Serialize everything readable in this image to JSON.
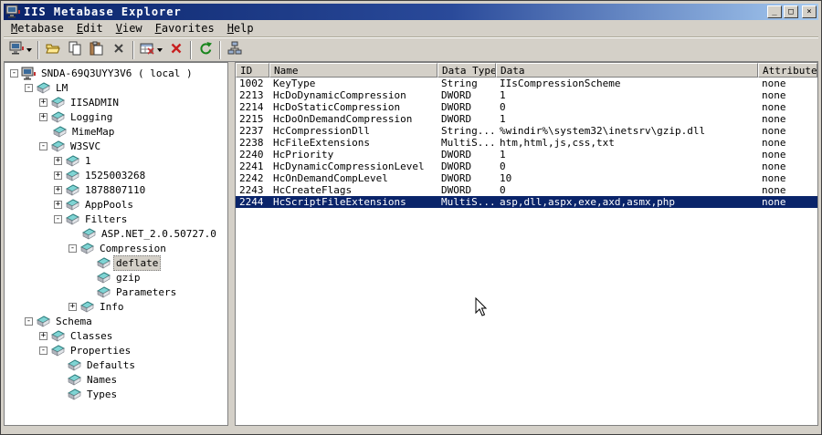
{
  "window": {
    "title": "IIS Metabase Explorer",
    "controls": {
      "minimize": "_",
      "maximize": "□",
      "close": "×"
    }
  },
  "menubar": {
    "items": [
      {
        "label": "Metabase"
      },
      {
        "label": "Edit"
      },
      {
        "label": "View"
      },
      {
        "label": "Favorites"
      },
      {
        "label": "Help"
      }
    ]
  },
  "toolbar": {
    "buttons": [
      {
        "type": "button",
        "name": "connect",
        "icon": "computer",
        "dropdown": true
      },
      {
        "type": "sep"
      },
      {
        "type": "button",
        "name": "open",
        "icon": "folder-open"
      },
      {
        "type": "button",
        "name": "copy",
        "icon": "copy"
      },
      {
        "type": "button",
        "name": "paste",
        "icon": "paste"
      },
      {
        "type": "button",
        "name": "delete",
        "icon": "delete-x"
      },
      {
        "type": "sep"
      },
      {
        "type": "button",
        "name": "new-record",
        "icon": "record-grid",
        "dropdown": true
      },
      {
        "type": "button",
        "name": "delete-record",
        "icon": "delete-red"
      },
      {
        "type": "sep"
      },
      {
        "type": "button",
        "name": "refresh",
        "icon": "refresh"
      },
      {
        "type": "sep"
      },
      {
        "type": "button",
        "name": "network",
        "icon": "network"
      }
    ]
  },
  "tree": {
    "items": [
      {
        "label": "SNDA-69Q3UYY3V6 ( local )",
        "level": 0,
        "expander": "minus",
        "icon": "computer",
        "selected": false
      },
      {
        "label": "LM",
        "level": 1,
        "expander": "minus",
        "icon": "key",
        "selected": false
      },
      {
        "label": "IISADMIN",
        "level": 2,
        "expander": "plus",
        "icon": "key",
        "selected": false
      },
      {
        "label": "Logging",
        "level": 2,
        "expander": "plus",
        "icon": "key",
        "selected": false
      },
      {
        "label": "MimeMap",
        "level": 2,
        "expander": "none",
        "icon": "key",
        "selected": false
      },
      {
        "label": "W3SVC",
        "level": 2,
        "expander": "minus",
        "icon": "key",
        "selected": false
      },
      {
        "label": "1",
        "level": 3,
        "expander": "plus",
        "icon": "key",
        "selected": false
      },
      {
        "label": "1525003268",
        "level": 3,
        "expander": "plus",
        "icon": "key",
        "selected": false
      },
      {
        "label": "1878807110",
        "level": 3,
        "expander": "plus",
        "icon": "key",
        "selected": false
      },
      {
        "label": "AppPools",
        "level": 3,
        "expander": "plus",
        "icon": "key",
        "selected": false
      },
      {
        "label": "Filters",
        "level": 3,
        "expander": "minus",
        "icon": "key",
        "selected": false
      },
      {
        "label": "ASP.NET_2.0.50727.0",
        "level": 4,
        "expander": "none",
        "icon": "key",
        "selected": false
      },
      {
        "label": "Compression",
        "level": 4,
        "expander": "minus",
        "icon": "key",
        "selected": false
      },
      {
        "label": "deflate",
        "level": 5,
        "expander": "none",
        "icon": "key",
        "selected": true
      },
      {
        "label": "gzip",
        "level": 5,
        "expander": "none",
        "icon": "key",
        "selected": false
      },
      {
        "label": "Parameters",
        "level": 5,
        "expander": "none",
        "icon": "key",
        "selected": false
      },
      {
        "label": "Info",
        "level": 4,
        "expander": "plus",
        "icon": "key",
        "selected": false
      },
      {
        "label": "Schema",
        "level": 1,
        "expander": "minus",
        "icon": "key",
        "selected": false
      },
      {
        "label": "Classes",
        "level": 2,
        "expander": "plus",
        "icon": "key",
        "selected": false
      },
      {
        "label": "Properties",
        "level": 2,
        "expander": "minus",
        "icon": "key",
        "selected": false
      },
      {
        "label": "Defaults",
        "level": 3,
        "expander": "none",
        "icon": "key",
        "selected": false
      },
      {
        "label": "Names",
        "level": 3,
        "expander": "none",
        "icon": "key",
        "selected": false
      },
      {
        "label": "Types",
        "level": 3,
        "expander": "none",
        "icon": "key",
        "selected": false
      }
    ]
  },
  "table": {
    "columns": [
      "ID",
      "Name",
      "Data Type",
      "Data",
      "Attributes"
    ],
    "rows": [
      [
        "1002",
        "KeyType",
        "String",
        "IIsCompressionScheme",
        "none"
      ],
      [
        "2213",
        "HcDoDynamicCompression",
        "DWORD",
        "1",
        "none"
      ],
      [
        "2214",
        "HcDoStaticCompression",
        "DWORD",
        "0",
        "none"
      ],
      [
        "2215",
        "HcDoOnDemandCompression",
        "DWORD",
        "1",
        "none"
      ],
      [
        "2237",
        "HcCompressionDll",
        "String...",
        "%windir%\\system32\\inetsrv\\gzip.dll",
        "none"
      ],
      [
        "2238",
        "HcFileExtensions",
        "MultiS...",
        "htm,html,js,css,txt",
        "none"
      ],
      [
        "2240",
        "HcPriority",
        "DWORD",
        "1",
        "none"
      ],
      [
        "2241",
        "HcDynamicCompressionLevel",
        "DWORD",
        "0",
        "none"
      ],
      [
        "2242",
        "HcOnDemandCompLevel",
        "DWORD",
        "10",
        "none"
      ],
      [
        "2243",
        "HcCreateFlags",
        "DWORD",
        "0",
        "none"
      ],
      [
        "2244",
        "HcScriptFileExtensions",
        "MultiS...",
        "asp,dll,aspx,exe,axd,asmx,php",
        "none"
      ]
    ],
    "selected_row": 10
  }
}
